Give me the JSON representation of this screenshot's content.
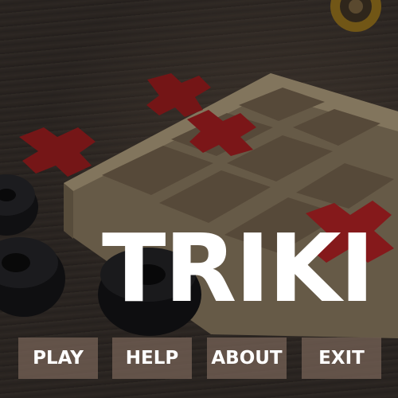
{
  "game": {
    "title": "TRIKI"
  },
  "menu": {
    "items": [
      {
        "label": "PLAY"
      },
      {
        "label": "HELP"
      },
      {
        "label": "ABOUT"
      },
      {
        "label": "EXIT"
      }
    ]
  },
  "colors": {
    "title_text": "#ffffff",
    "button_bg": "#736054",
    "button_text": "#ffffff",
    "piece_x": "#b41f22",
    "piece_o": "#1c1c1e",
    "board_wood": "#9b8a6d"
  },
  "icons": {
    "background": "tic-tac-toe-board-photo"
  }
}
